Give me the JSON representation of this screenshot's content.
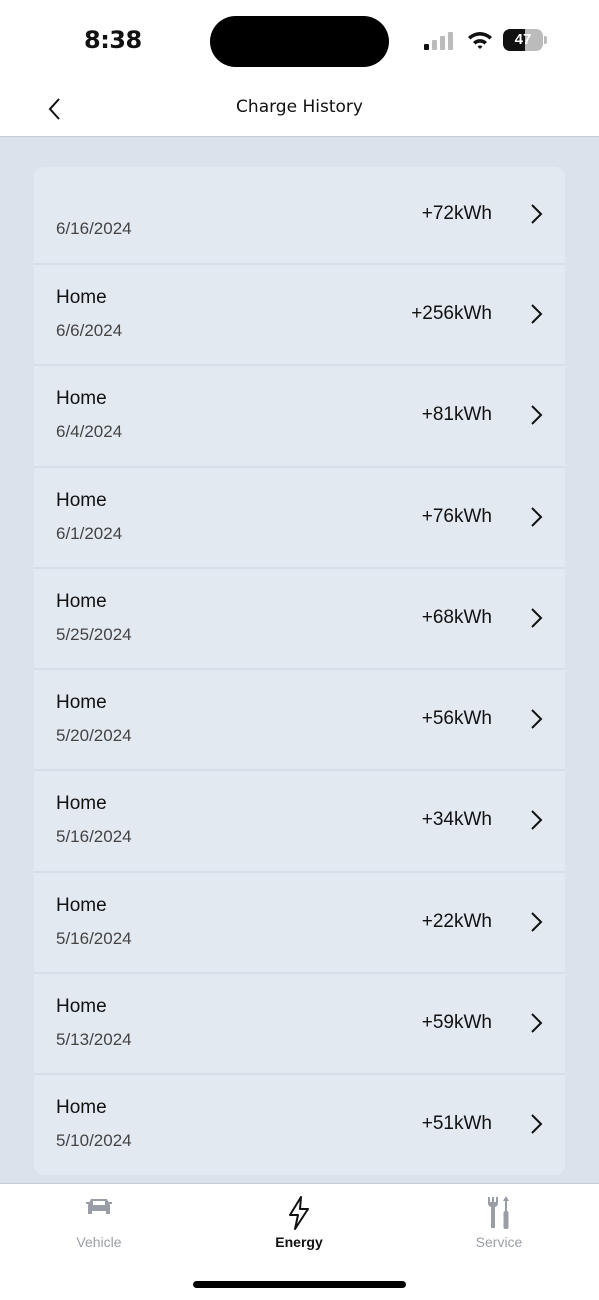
{
  "status_bar": {
    "time": "8:38",
    "battery": "47"
  },
  "header": {
    "title": "Charge History"
  },
  "sessions": [
    {
      "location": "",
      "date": "6/16/2024",
      "energy": "+72kWh"
    },
    {
      "location": "Home",
      "date": "6/6/2024",
      "energy": "+256kWh"
    },
    {
      "location": "Home",
      "date": "6/4/2024",
      "energy": "+81kWh"
    },
    {
      "location": "Home",
      "date": "6/1/2024",
      "energy": "+76kWh"
    },
    {
      "location": "Home",
      "date": "5/25/2024",
      "energy": "+68kWh"
    },
    {
      "location": "Home",
      "date": "5/20/2024",
      "energy": "+56kWh"
    },
    {
      "location": "Home",
      "date": "5/16/2024",
      "energy": "+34kWh"
    },
    {
      "location": "Home",
      "date": "5/16/2024",
      "energy": "+22kWh"
    },
    {
      "location": "Home",
      "date": "5/13/2024",
      "energy": "+59kWh"
    },
    {
      "location": "Home",
      "date": "5/10/2024",
      "energy": "+51kWh"
    }
  ],
  "tabs": [
    {
      "label": "Vehicle",
      "icon": "car-icon",
      "active": false
    },
    {
      "label": "Energy",
      "icon": "lightning-icon",
      "active": true
    },
    {
      "label": "Service",
      "icon": "tools-icon",
      "active": false
    }
  ]
}
